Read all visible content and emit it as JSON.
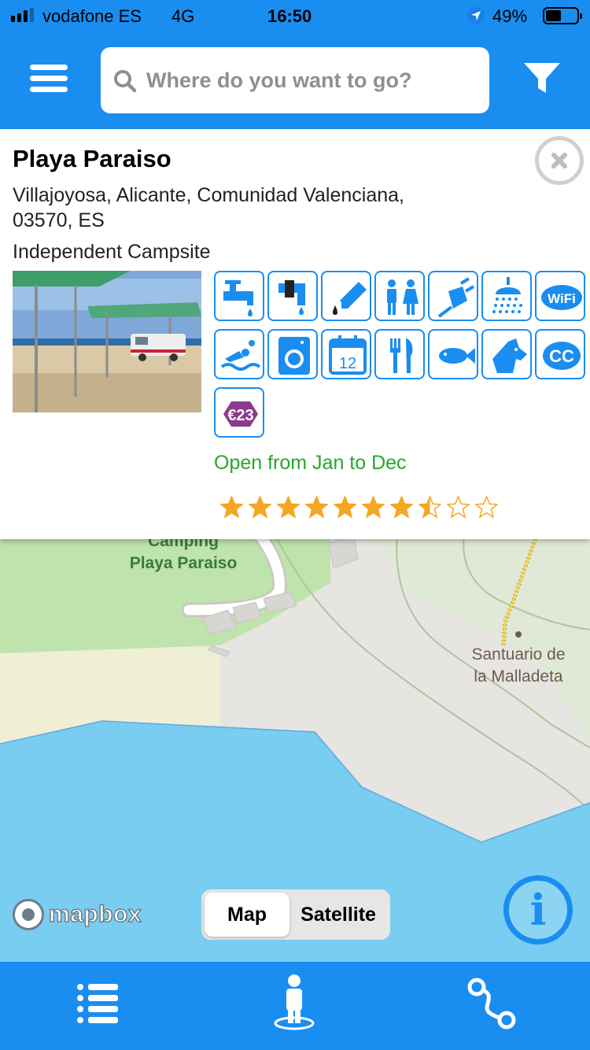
{
  "status_bar": {
    "carrier": "vodafone ES",
    "network": "4G",
    "time": "16:50",
    "battery_percent_text": "49%",
    "battery_level": 0.49,
    "signal_bars": 3,
    "location_icon": "location-arrow-icon"
  },
  "header": {
    "menu_icon": "hamburger-menu-icon",
    "search_placeholder": "Where do you want to go?",
    "search_value": "",
    "filter_icon": "filter-funnel-icon"
  },
  "campsite": {
    "name": "Playa Paraiso",
    "address": "Villajoyosa, Alicante, Comunidad Valenciana, 03570, ES",
    "type": "Independent Campsite",
    "open_period": "Open from Jan to Dec",
    "rating": 7.5,
    "rating_max": 10,
    "price_badge": "€23",
    "calendar_day": "12",
    "amenities": [
      "drinking-water-icon",
      "water-refill-icon",
      "waste-disposal-icon",
      "toilets-icon",
      "electricity-icon",
      "shower-icon",
      "wifi-icon",
      "swimming-icon",
      "washing-machine-icon",
      "calendar-icon",
      "restaurant-icon",
      "fishing-icon",
      "pets-allowed-icon",
      "camping-card-icon",
      "price-icon"
    ],
    "wifi_label": "WiFi",
    "card_label": "CC"
  },
  "map": {
    "campsite_label": "Camping\nPlaya Paraiso",
    "poi_label": "Santuario de\nla Malladeta",
    "attribution": "mapbox",
    "view_modes": [
      "Map",
      "Satellite"
    ],
    "active_view": "Map",
    "info_glyph": "i"
  },
  "bottom_nav": {
    "items": [
      "list-icon",
      "person-location-icon",
      "route-icon"
    ]
  },
  "colors": {
    "brand_blue": "#1a8df0",
    "open_green": "#2aa52a",
    "star_gold": "#f5a623",
    "water": "#78cdf0",
    "park_green": "#bfe3ad"
  }
}
